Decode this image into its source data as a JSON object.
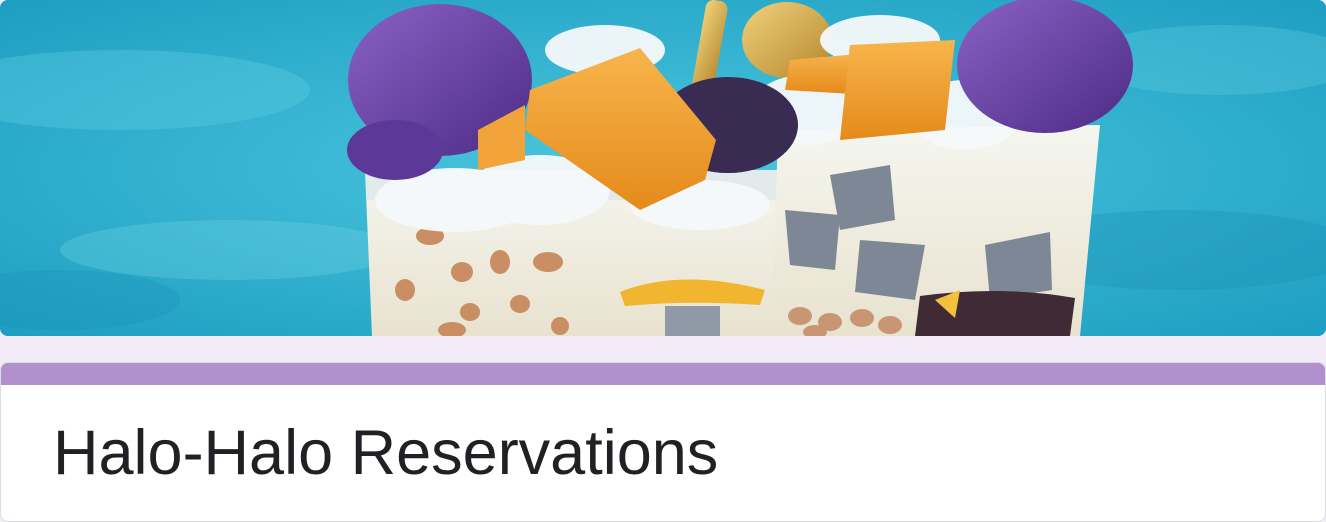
{
  "theme": {
    "page_background": "#f3ebf7",
    "accent": "#b28fcd",
    "card_background": "#ffffff",
    "title_color": "#202124"
  },
  "header_image": {
    "icon": "halo-halo-dessert-image"
  },
  "form": {
    "title": "Halo-Halo Reservations"
  }
}
